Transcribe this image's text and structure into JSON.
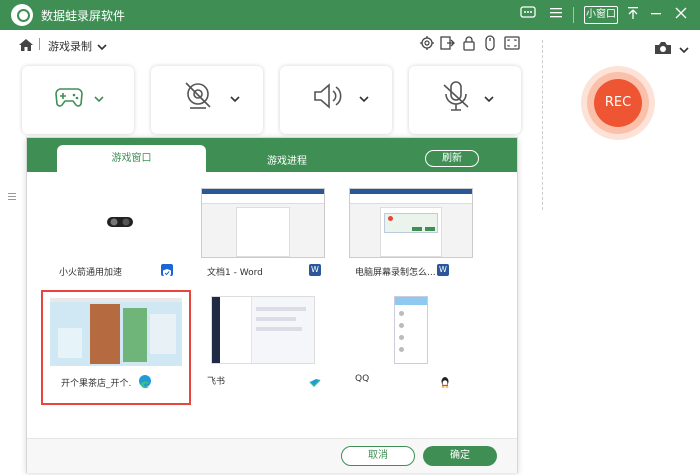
{
  "app": {
    "title": "数据蛙录屏软件",
    "mini_window_label": "小窗口",
    "accent_color": "#3f8f54",
    "rec_color": "#ee5532"
  },
  "subbar": {
    "breadcrumb": "游戏录制",
    "tools": [
      "settings-icon",
      "export-icon",
      "lock-icon",
      "mouse-icon",
      "fullscreen-icon"
    ]
  },
  "cards": [
    {
      "name": "gamepad",
      "icon": "gamepad-icon"
    },
    {
      "name": "webcam",
      "icon": "webcam-off-icon"
    },
    {
      "name": "system-sound",
      "icon": "speaker-icon"
    },
    {
      "name": "microphone",
      "icon": "microphone-off-icon"
    }
  ],
  "rec": {
    "label": "REC"
  },
  "dialog": {
    "tab_window": "游戏窗口",
    "tab_process": "游戏进程",
    "refresh": "刷新",
    "items": [
      {
        "label": "小火箭通用加速",
        "icon": "rocket-shield-icon",
        "selected": false
      },
      {
        "label": "文档1 - Word",
        "icon": "word-icon",
        "selected": false
      },
      {
        "label": "电脑屏幕录制怎么...",
        "icon": "word-icon",
        "selected": false
      },
      {
        "label": "开个果茶店_开个...",
        "icon": "edge-icon",
        "selected": true
      },
      {
        "label": "飞书",
        "icon": "feishu-icon",
        "selected": false
      },
      {
        "label": "QQ",
        "icon": "qq-icon",
        "selected": false
      }
    ],
    "cancel": "取消",
    "confirm": "确定"
  }
}
